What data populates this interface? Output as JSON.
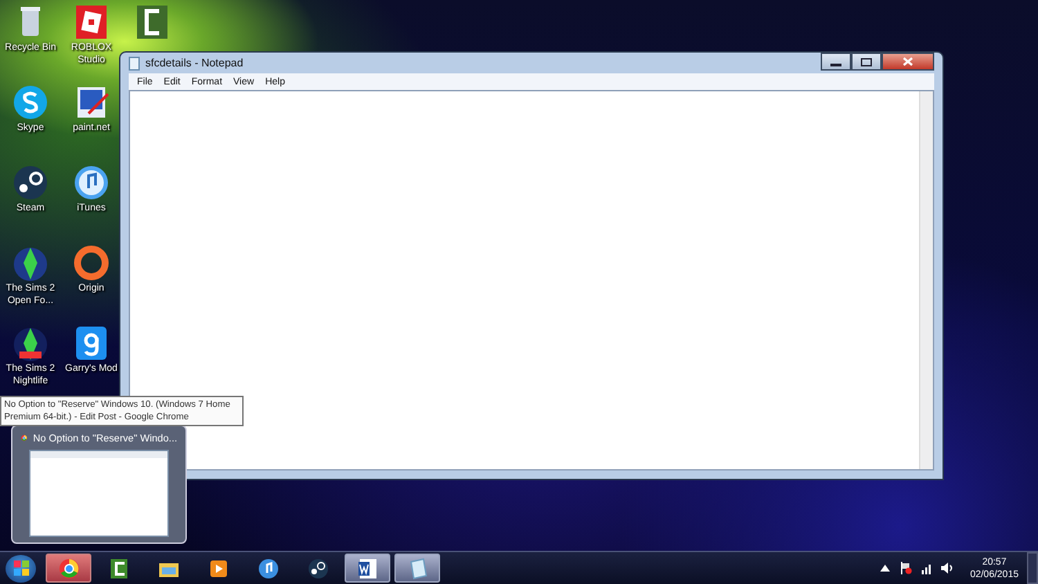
{
  "desktop_icons": [
    {
      "label": "Recycle Bin"
    },
    {
      "label": "Skype"
    },
    {
      "label": "Steam"
    },
    {
      "label": "The Sims 2 Open Fo..."
    },
    {
      "label": "The Sims 2 Nightlife"
    },
    {
      "label": "ROBLOX Studio"
    },
    {
      "label": "paint.net"
    },
    {
      "label": "iTunes"
    },
    {
      "label": "Origin"
    },
    {
      "label": "Garry's Mod"
    }
  ],
  "notepad": {
    "title": "sfcdetails - Notepad",
    "menu": [
      "File",
      "Edit",
      "Format",
      "View",
      "Help"
    ]
  },
  "tooltip": {
    "text": "No Option to \"Reserve\" Windows 10. (Windows 7 Home Premium 64-bit.) - Edit Post - Google Chrome"
  },
  "thumbnail": {
    "title": "No Option to \"Reserve\" Windo..."
  },
  "taskbar": {
    "items": [
      {
        "open": true,
        "highlighted": true
      },
      {
        "open": false,
        "highlighted": false
      },
      {
        "open": false,
        "highlighted": false
      },
      {
        "open": false,
        "highlighted": false
      },
      {
        "open": false,
        "highlighted": false
      },
      {
        "open": false,
        "highlighted": false
      },
      {
        "open": true,
        "highlighted": false
      },
      {
        "open": true,
        "highlighted": false
      }
    ]
  },
  "tray": {
    "time": "20:57",
    "date": "02/06/2015"
  }
}
